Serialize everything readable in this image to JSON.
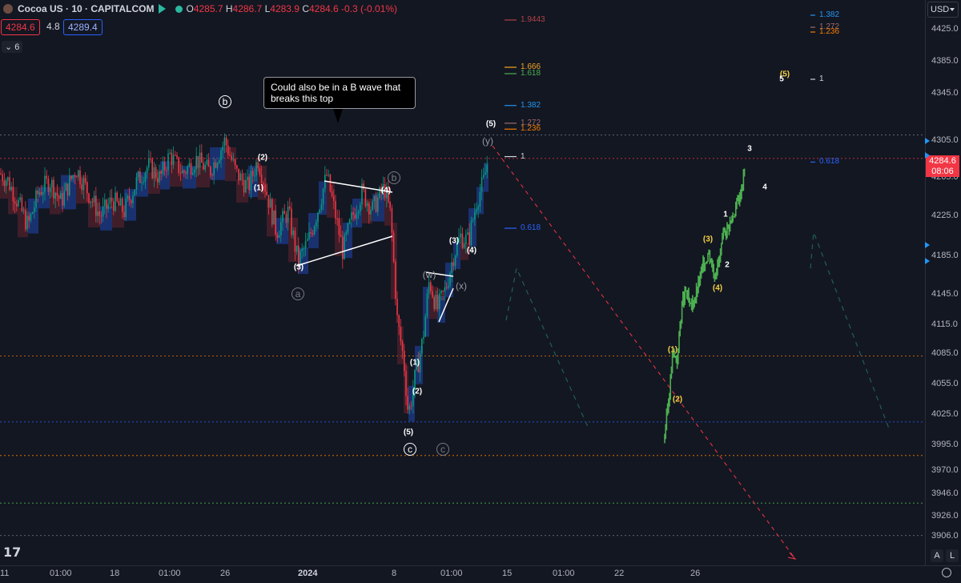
{
  "header": {
    "symbol": "Cocoa US · 10 · CAPITALCOM",
    "open_label": "O",
    "open": "4285.7",
    "high_label": "H",
    "high": "4286.7",
    "low_label": "L",
    "low": "4283.9",
    "close_label": "C",
    "close": "4284.6",
    "change": "-0.3 (-0.01%)",
    "bid": "4284.6",
    "spread": "4.8",
    "ask": "4289.4",
    "indicators_count": "6"
  },
  "currency": "USD",
  "current_price": {
    "value": "4284.6",
    "countdown": "08:06"
  },
  "callout_text": "Could also be in a B wave that breaks this top",
  "colors": {
    "background": "#131722",
    "up": "#089981",
    "down": "#f23645",
    "projection": "#4caf50"
  },
  "chart_data": {
    "type": "candlestick",
    "ylim": [
      3890,
      4445
    ],
    "y_ticks": [
      "4425.0",
      "4385.0",
      "4345.0",
      "4305.0",
      "4265.0",
      "4225.0",
      "4185.0",
      "4145.0",
      "4115.0",
      "4085.0",
      "4055.0",
      "4025.0",
      "3995.0",
      "3970.0",
      "3946.0",
      "3926.0",
      "3906.0"
    ],
    "x_ticks": [
      "11",
      "01:00",
      "18",
      "01:00",
      "26",
      "2024",
      "8",
      "01:00",
      "15",
      "01:00",
      "22",
      "26"
    ],
    "x_ticks_bold": [
      "2024"
    ],
    "price_path": [
      [
        0,
        4270
      ],
      [
        10,
        4262
      ],
      [
        22,
        4240
      ],
      [
        35,
        4215
      ],
      [
        48,
        4250
      ],
      [
        62,
        4262
      ],
      [
        76,
        4240
      ],
      [
        95,
        4275
      ],
      [
        110,
        4250
      ],
      [
        125,
        4225
      ],
      [
        140,
        4242
      ],
      [
        155,
        4230
      ],
      [
        170,
        4260
      ],
      [
        185,
        4278
      ],
      [
        200,
        4265
      ],
      [
        212,
        4290
      ],
      [
        228,
        4270
      ],
      [
        245,
        4285
      ],
      [
        262,
        4272
      ],
      [
        281,
        4305
      ],
      [
        295,
        4270
      ],
      [
        310,
        4255
      ],
      [
        322,
        4285
      ],
      [
        333,
        4250
      ],
      [
        345,
        4210
      ],
      [
        360,
        4230
      ],
      [
        372,
        4180
      ],
      [
        385,
        4200
      ],
      [
        398,
        4235
      ],
      [
        408,
        4268
      ],
      [
        418,
        4230
      ],
      [
        428,
        4190
      ],
      [
        440,
        4225
      ],
      [
        452,
        4250
      ],
      [
        465,
        4232
      ],
      [
        480,
        4255
      ],
      [
        488,
        4225
      ],
      [
        496,
        4120
      ],
      [
        504,
        4080
      ],
      [
        510,
        4025
      ],
      [
        518,
        4060
      ],
      [
        528,
        4100
      ],
      [
        536,
        4160
      ],
      [
        546,
        4130
      ],
      [
        556,
        4150
      ],
      [
        566,
        4185
      ],
      [
        575,
        4205
      ],
      [
        585,
        4200
      ],
      [
        595,
        4240
      ],
      [
        604,
        4262
      ],
      [
        610,
        4288
      ]
    ],
    "projection_path": [
      [
        830,
        4005
      ],
      [
        836,
        4048
      ],
      [
        840,
        4085
      ],
      [
        846,
        4080
      ],
      [
        850,
        4125
      ],
      [
        856,
        4150
      ],
      [
        862,
        4130
      ],
      [
        870,
        4148
      ],
      [
        878,
        4175
      ],
      [
        885,
        4190
      ],
      [
        892,
        4168
      ],
      [
        898,
        4180
      ],
      [
        905,
        4210
      ],
      [
        912,
        4218
      ],
      [
        918,
        4232
      ],
      [
        925,
        4250
      ],
      [
        930,
        4275
      ]
    ],
    "fib_levels_left": [
      {
        "label": "1.9443",
        "value": 4437,
        "color": "#b24248"
      },
      {
        "label": "1.666",
        "value": 4378,
        "color": "#f5a623"
      },
      {
        "label": "1.618",
        "value": 4370,
        "color": "#4caf50"
      },
      {
        "label": "1.382",
        "value": 4335,
        "color": "#2196f3"
      },
      {
        "label": "1.272",
        "value": 4320,
        "color": "#9e6b6b"
      },
      {
        "label": "1.236",
        "value": 4315,
        "color": "#f57c00"
      },
      {
        "label": "1",
        "value": 4288,
        "color": "#d1d4dc"
      },
      {
        "label": "0.618",
        "value": 4213,
        "color": "#2962ff"
      }
    ],
    "fib_levels_right": [
      {
        "label": "1.382",
        "value": 4443,
        "color": "#2196f3"
      },
      {
        "label": "1.272",
        "value": 4428,
        "color": "#9e6b6b"
      },
      {
        "label": "1.236",
        "value": 4422,
        "color": "#f57c00"
      },
      {
        "label": "1",
        "value": 4363,
        "color": "#d1d4dc"
      },
      {
        "label": "0.618",
        "value": 4282,
        "color": "#2962ff"
      }
    ],
    "horizontal_lines": [
      {
        "value": 4310,
        "color": "#787b86",
        "style": "dotted"
      },
      {
        "value": 4286,
        "color": "#f23645",
        "style": "dotted"
      },
      {
        "value": 4083,
        "color": "#f57c00",
        "style": "dotted"
      },
      {
        "value": 4018,
        "color": "#2962ff",
        "style": "dotted"
      },
      {
        "value": 3985,
        "color": "#f57c00",
        "style": "dotted"
      },
      {
        "value": 3938,
        "color": "#4caf50",
        "style": "dotted"
      },
      {
        "value": 3907,
        "color": "#787b86",
        "style": "dotted"
      }
    ],
    "wave_labels": [
      {
        "text": "(2)",
        "x": 328,
        "y": 4287,
        "color": "white"
      },
      {
        "text": "(1)",
        "x": 323,
        "y": 4254,
        "color": "white"
      },
      {
        "text": "(3)",
        "x": 373,
        "y": 4173,
        "color": "white"
      },
      {
        "text": "(4)",
        "x": 482,
        "y": 4252,
        "color": "white"
      },
      {
        "text": "(3)",
        "x": 567,
        "y": 4200,
        "color": "white"
      },
      {
        "text": "(4)",
        "x": 589,
        "y": 4191,
        "color": "white"
      },
      {
        "text": "(1)",
        "x": 518,
        "y": 4076,
        "color": "white"
      },
      {
        "text": "(2)",
        "x": 521,
        "y": 4048,
        "color": "white"
      },
      {
        "text": "(5)",
        "x": 510,
        "y": 4008,
        "color": "white"
      },
      {
        "text": "(5)",
        "x": 613,
        "y": 4319,
        "color": "white"
      },
      {
        "text": "(w)",
        "x": 536,
        "y": 4166,
        "color": "grey"
      },
      {
        "text": "(x)",
        "x": 576,
        "y": 4154,
        "color": "grey"
      },
      {
        "text": "(y)",
        "x": 609,
        "y": 4305,
        "color": "grey"
      },
      {
        "text": "(5)",
        "x": 980,
        "y": 4369,
        "color": "yellow"
      },
      {
        "text": "5",
        "x": 976,
        "y": 4363,
        "color": "white"
      },
      {
        "text": "3",
        "x": 936,
        "y": 4296,
        "color": "white"
      },
      {
        "text": "4",
        "x": 955,
        "y": 4255,
        "color": "white"
      },
      {
        "text": "1",
        "x": 906,
        "y": 4227,
        "color": "white"
      },
      {
        "text": "(3)",
        "x": 884,
        "y": 4202,
        "color": "yellow"
      },
      {
        "text": "2",
        "x": 908,
        "y": 4176,
        "color": "white"
      },
      {
        "text": "(4)",
        "x": 896,
        "y": 4152,
        "color": "yellow"
      },
      {
        "text": "(1)",
        "x": 840,
        "y": 4089,
        "color": "yellow"
      },
      {
        "text": "(2)",
        "x": 846,
        "y": 4040,
        "color": "yellow"
      }
    ],
    "circle_labels": [
      {
        "text": "b",
        "x": 281,
        "y": 4338,
        "color": "white"
      },
      {
        "text": "a",
        "x": 372,
        "y": 4146,
        "color": "grey"
      },
      {
        "text": "b",
        "x": 492,
        "y": 4265,
        "color": "grey"
      },
      {
        "text": "c",
        "x": 512,
        "y": 3991,
        "color": "white"
      },
      {
        "text": "c",
        "x": 553,
        "y": 3991,
        "color": "grey"
      }
    ]
  }
}
